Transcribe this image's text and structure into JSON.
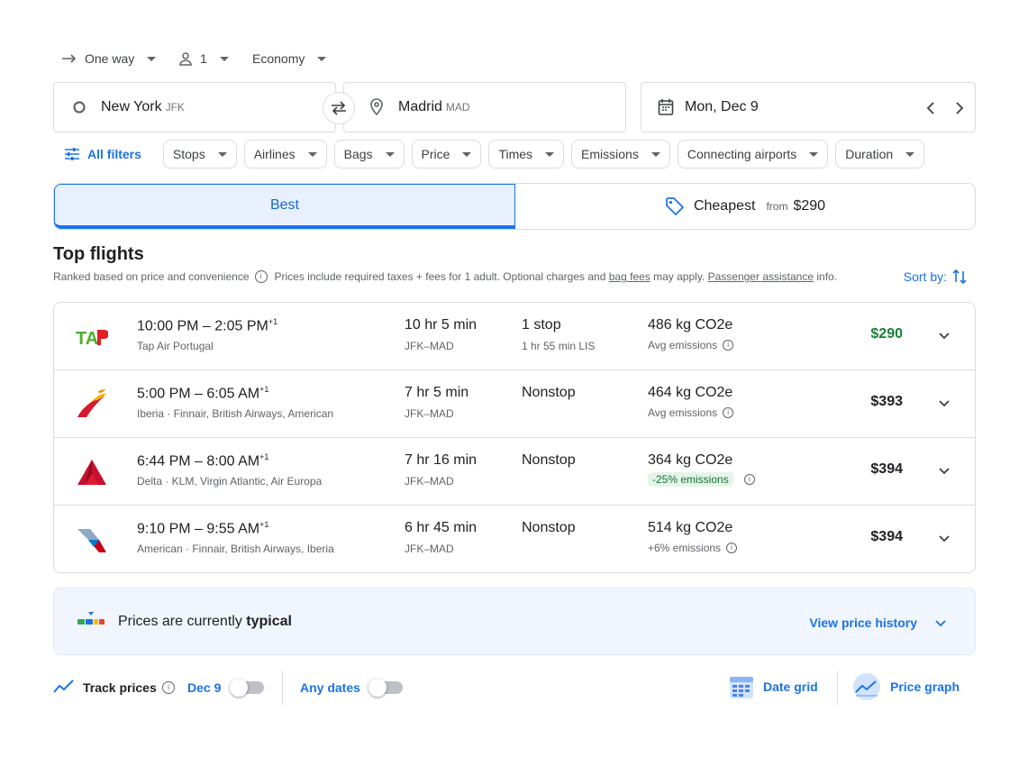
{
  "trip": {
    "type_label": "One way",
    "passengers": "1",
    "cabin": "Economy"
  },
  "search": {
    "origin_city": "New York",
    "origin_code": "JFK",
    "destination_city": "Madrid",
    "destination_code": "MAD",
    "date": "Mon, Dec 9"
  },
  "filters": {
    "all_label": "All filters",
    "chips": [
      "Stops",
      "Airlines",
      "Bags",
      "Price",
      "Times",
      "Emissions",
      "Connecting airports",
      "Duration"
    ]
  },
  "tabs": {
    "best": "Best",
    "cheapest": "Cheapest",
    "from_label": "from",
    "cheapest_price": "$290"
  },
  "results": {
    "title": "Top flights",
    "ranked_text": "Ranked based on price and convenience",
    "prices_text": "Prices include required taxes + fees for 1 adult. Optional charges and",
    "bag_fees": "bag fees",
    "may_apply": "may apply.",
    "passenger_assistance": "Passenger assistance",
    "info_suffix": "info.",
    "sort_label": "Sort by:"
  },
  "flights": [
    {
      "times": "10:00 PM – 2:05 PM",
      "plus_day": "+1",
      "airline": "Tap Air Portugal",
      "duration": "10 hr 5 min",
      "route": "JFK–MAD",
      "stops": "1 stop",
      "stop_detail": "1 hr 55 min LIS",
      "co2": "486 kg CO2e",
      "emissions": "Avg emissions",
      "price": "$290",
      "logo_icon": "tap-logo-icon"
    },
    {
      "times": "5:00 PM – 6:05 AM",
      "plus_day": "+1",
      "airline": "Iberia · Finnair, British Airways, American",
      "duration": "7 hr 5 min",
      "route": "JFK–MAD",
      "stops": "Nonstop",
      "stop_detail": "",
      "co2": "464 kg CO2e",
      "emissions": "Avg emissions",
      "price": "$393",
      "logo_icon": "iberia-logo-icon"
    },
    {
      "times": "6:44 PM – 8:00 AM",
      "plus_day": "+1",
      "airline": "Delta · KLM, Virgin Atlantic, Air Europa",
      "duration": "7 hr 16 min",
      "route": "JFK–MAD",
      "stops": "Nonstop",
      "stop_detail": "",
      "co2": "364 kg CO2e",
      "emissions": "-25% emissions",
      "price": "$394",
      "logo_icon": "delta-logo-icon"
    },
    {
      "times": "9:10 PM – 9:55 AM",
      "plus_day": "+1",
      "airline": "American · Finnair, British Airways, Iberia",
      "duration": "6 hr 45 min",
      "route": "JFK–MAD",
      "stops": "Nonstop",
      "stop_detail": "",
      "co2": "514 kg CO2e",
      "emissions": "+6% emissions",
      "price": "$394",
      "logo_icon": "american-logo-icon"
    }
  ],
  "insight": {
    "prefix": "Prices are currently",
    "status": "typical",
    "link": "View price history"
  },
  "bottom": {
    "track_label": "Track prices",
    "date_label": "Dec 9",
    "any_dates": "Any dates",
    "date_grid": "Date grid",
    "price_graph": "Price graph"
  },
  "colors": {
    "accent": "#1a73e8",
    "best_tab_bg": "#e8f0fe",
    "cheap_price": "#188038",
    "green_badge_bg": "#e6f4ea"
  }
}
